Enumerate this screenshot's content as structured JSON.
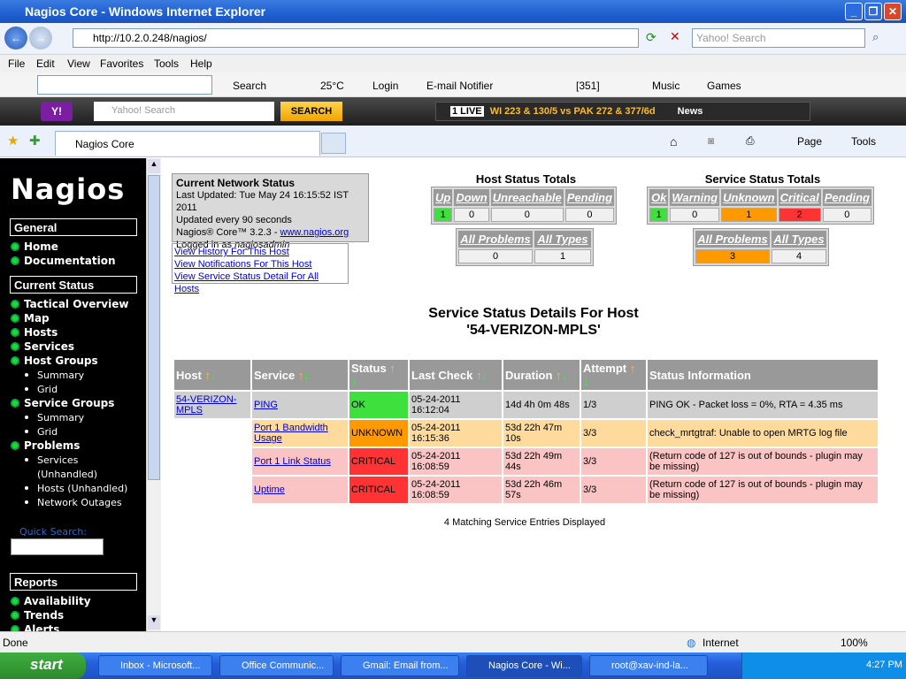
{
  "window": {
    "title": "Nagios Core - Windows Internet Explorer",
    "url": "http://10.2.0.248/nagios/",
    "search_placeholder": "Yahoo! Search"
  },
  "menu": [
    "File",
    "Edit",
    "View",
    "Favorites",
    "Tools",
    "Help"
  ],
  "toolbar": {
    "search": "Search",
    "weather": "25°C",
    "login": "Login",
    "notifier": "E-mail Notifier",
    "counter": "[351]",
    "music": "Music",
    "games": "Games"
  },
  "yahoo": {
    "placeholder": "Yahoo! Search",
    "button": "SEARCH",
    "score": "WI 223 & 130/5 vs PAK 272 & 377/6d",
    "live": "1 LIVE",
    "news": "News"
  },
  "tab": {
    "label": "Nagios Core"
  },
  "cmdbar": {
    "page": "Page",
    "tools": "Tools"
  },
  "sidebar": {
    "logo": "Nagios",
    "general": "General",
    "general_items": [
      "Home",
      "Documentation"
    ],
    "current_status": "Current Status",
    "items": {
      "tactical": "Tactical Overview",
      "map": "Map",
      "hosts": "Hosts",
      "services": "Services",
      "host_groups": "Host Groups",
      "hg_summary": "Summary",
      "hg_grid": "Grid",
      "service_groups": "Service Groups",
      "sg_summary": "Summary",
      "sg_grid": "Grid",
      "problems": "Problems",
      "services_unh": "Services",
      "services_unh2": "(Unhandled)",
      "hosts_unh": "Hosts (Unhandled)",
      "outages": "Network Outages"
    },
    "quick_search": "Quick Search:",
    "reports": "Reports",
    "report_items": [
      "Availability",
      "Trends",
      "Alerts"
    ]
  },
  "info": {
    "title": "Current Network Status",
    "updated": "Last Updated: Tue May 24 16:15:52 IST 2011",
    "interval": "Updated every 90 seconds",
    "version": "Nagios® Core™ 3.2.3 - ",
    "site": "www.nagios.org",
    "logged": "Logged in as ",
    "user": "nagiosadmin"
  },
  "links": [
    "View History For This Host",
    "View Notifications For This Host",
    "View Service Status Detail For All Hosts"
  ],
  "host_totals": {
    "title": "Host Status Totals",
    "headers": [
      "Up",
      "Down",
      "Unreachable",
      "Pending"
    ],
    "values": [
      "1",
      "0",
      "0",
      "0"
    ],
    "all_headers": [
      "All Problems",
      "All Types"
    ],
    "all_values": [
      "0",
      "1"
    ]
  },
  "service_totals": {
    "title": "Service Status Totals",
    "headers": [
      "Ok",
      "Warning",
      "Unknown",
      "Critical",
      "Pending"
    ],
    "values": [
      "1",
      "0",
      "1",
      "2",
      "0"
    ],
    "all_headers": [
      "All Problems",
      "All Types"
    ],
    "all_values": [
      "3",
      "4"
    ]
  },
  "details": {
    "title": "Service Status Details For Host",
    "host": "'54-VERIZON-MPLS'"
  },
  "table": {
    "headers": [
      "Host",
      "Service",
      "Status",
      "Last Check",
      "Duration",
      "Attempt",
      "Status Information"
    ],
    "host": "54-VERIZON-MPLS",
    "rows": [
      {
        "service": "PING",
        "status": "OK",
        "last": "05-24-2011 16:12:04",
        "duration": "14d 4h 0m 48s",
        "attempt": "1/3",
        "info": "PING OK - Packet loss = 0%, RTA = 4.35 ms"
      },
      {
        "service": "Port 1 Bandwidth Usage",
        "status": "UNKNOWN",
        "last": "05-24-2011 16:15:36",
        "duration": "53d 22h 47m 10s",
        "attempt": "3/3",
        "info": "check_mrtgtraf: Unable to open MRTG log file"
      },
      {
        "service": "Port 1 Link Status",
        "status": "CRITICAL",
        "last": "05-24-2011 16:08:59",
        "duration": "53d 22h 49m 44s",
        "attempt": "3/3",
        "info": "(Return code of 127 is out of bounds - plugin may be missing)"
      },
      {
        "service": "Uptime",
        "status": "CRITICAL",
        "last": "05-24-2011 16:08:59",
        "duration": "53d 22h 46m 57s",
        "attempt": "3/3",
        "info": "(Return code of 127 is out of bounds - plugin may be missing)"
      }
    ],
    "footer": "4 Matching Service Entries Displayed"
  },
  "statusbar": {
    "left": "Done",
    "zone": "Internet",
    "zoom": "100%"
  },
  "taskbar": {
    "start": "start",
    "tasks": [
      "Inbox - Microsoft...",
      "Office Communic...",
      "Gmail: Email from...",
      "Nagios Core - Wi...",
      "root@xav-ind-la..."
    ],
    "clock": "4:27 PM"
  }
}
